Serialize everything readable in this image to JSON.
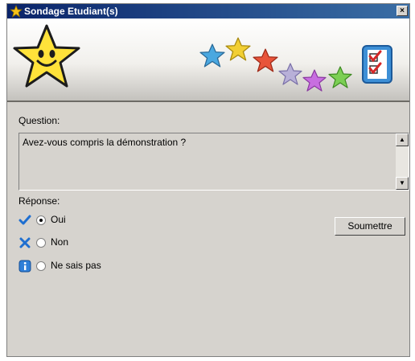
{
  "window": {
    "title": "Sondage Etudiant(s)",
    "close_glyph": "×",
    "app_icon": "star-icon"
  },
  "banner": {
    "mascot": "smiling-star-icon",
    "stars": [
      {
        "icon": "star-icon",
        "color": "#4aa8e0"
      },
      {
        "icon": "star-icon",
        "color": "#f2cf33"
      },
      {
        "icon": "star-icon",
        "color": "#e8543a"
      },
      {
        "icon": "star-icon",
        "color": "#b8b0d8"
      },
      {
        "icon": "star-icon",
        "color": "#c86ee0"
      },
      {
        "icon": "star-icon",
        "color": "#7ccf54"
      }
    ],
    "checklist_icon": "checklist-icon"
  },
  "question": {
    "label": "Question:",
    "text": "Avez-vous compris la démonstration ?"
  },
  "answer": {
    "label": "Réponse:",
    "options": [
      {
        "icon": "checkmark-icon",
        "label": "Oui",
        "checked": true
      },
      {
        "icon": "cross-icon",
        "label": "Non",
        "checked": false
      },
      {
        "icon": "info-icon",
        "label": "Ne sais pas",
        "checked": false
      }
    ]
  },
  "submit_label": "Soumettre"
}
